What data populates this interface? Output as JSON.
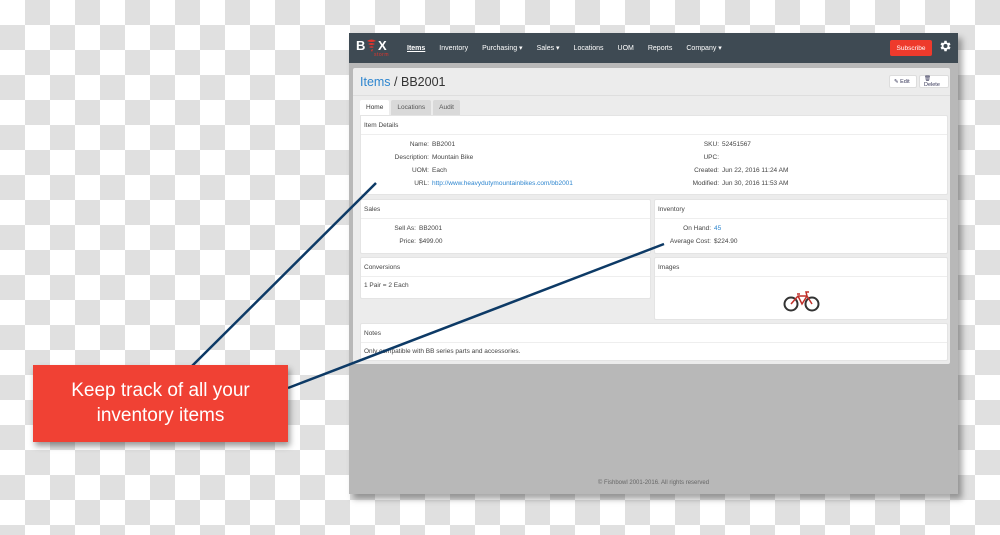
{
  "app": {
    "logo_text_left": "B",
    "logo_text_right": "X",
    "logo_subtext": "storm",
    "logo_icon": "tornado-icon"
  },
  "navbar": {
    "items": [
      {
        "label": "Items",
        "active": true
      },
      {
        "label": "Inventory"
      },
      {
        "label": "Purchasing ▾"
      },
      {
        "label": "Sales ▾"
      },
      {
        "label": "Locations"
      },
      {
        "label": "UOM"
      },
      {
        "label": "Reports"
      },
      {
        "label": "Company ▾"
      }
    ],
    "subscribe_label": "Subscribe",
    "settings_icon": "gear-icon"
  },
  "page": {
    "breadcrumb_root": "Items",
    "breadcrumb_sep": " / ",
    "title": "BB2001",
    "edit_label": "✎ Edit",
    "delete_label": "🗑 Delete"
  },
  "tabs": [
    {
      "label": "Home",
      "active": true
    },
    {
      "label": "Locations"
    },
    {
      "label": "Audit"
    }
  ],
  "item_details": {
    "heading": "Item Details",
    "left": [
      {
        "label": "Name:",
        "value": "BB2001"
      },
      {
        "label": "Description:",
        "value": "Mountain Bike"
      },
      {
        "label": "UOM:",
        "value": "Each"
      },
      {
        "label": "URL:",
        "value": "http://www.heavydutymountainbikes.com/bb2001",
        "link": true
      }
    ],
    "right": [
      {
        "label": "SKU:",
        "value": "52451567"
      },
      {
        "label": "UPC:",
        "value": ""
      },
      {
        "label": "Created:",
        "value": "Jun 22, 2016 11:24 AM"
      },
      {
        "label": "Modified:",
        "value": "Jun 30, 2016 11:53 AM"
      }
    ]
  },
  "sales": {
    "heading": "Sales",
    "rows": [
      {
        "label": "Sell As:",
        "value": "BB2001"
      },
      {
        "label": "Price:",
        "value": "$499.00"
      }
    ]
  },
  "inventory": {
    "heading": "Inventory",
    "rows": [
      {
        "label": "On Hand:",
        "value": "45",
        "link": true
      },
      {
        "label": "Average Cost:",
        "value": "$224.90"
      }
    ]
  },
  "conversions": {
    "heading": "Conversions",
    "text": "1 Pair = 2 Each"
  },
  "images": {
    "heading": "Images",
    "image_icon": "bicycle-icon"
  },
  "notes": {
    "heading": "Notes",
    "text": "Only compatible with BB series parts and accessories."
  },
  "footer": {
    "text": "© Fishbowl 2001-2016. All rights reserved"
  },
  "callout": {
    "line1": "Keep track of all your",
    "line2": "inventory items"
  },
  "colors": {
    "navbar": "#3e4a53",
    "accent_link": "#2e86cf",
    "subscribe": "#ee3a2c",
    "callout": "#f04134",
    "connector": "#0d3a66"
  }
}
